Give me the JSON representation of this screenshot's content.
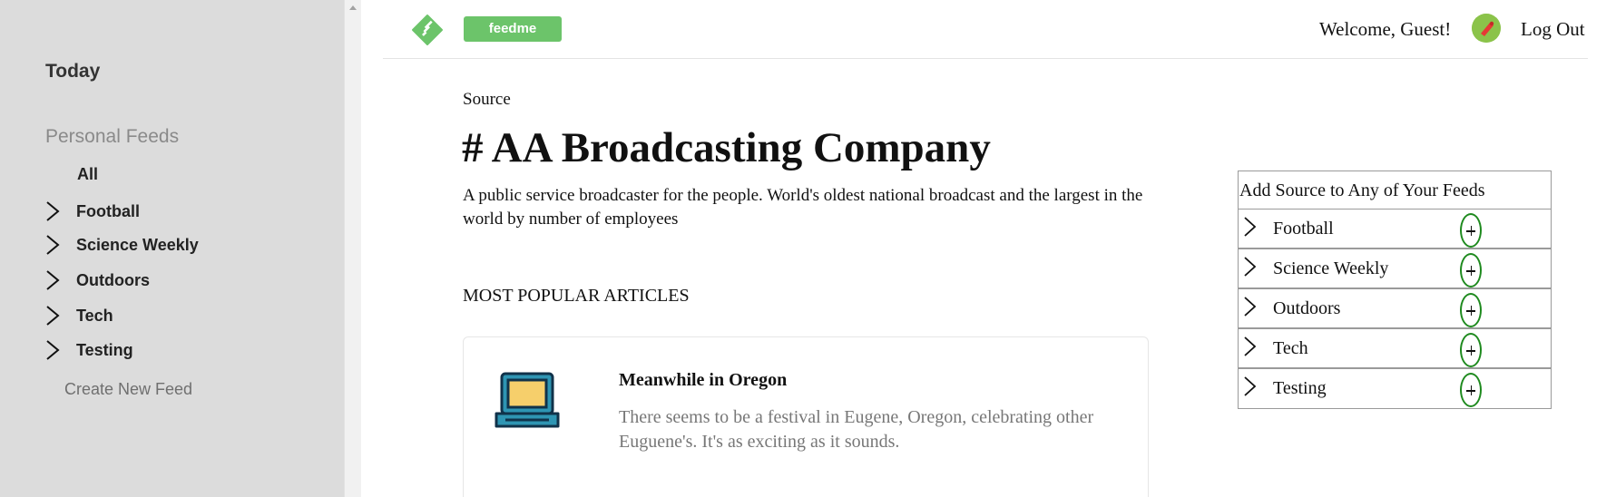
{
  "sidebar": {
    "today": "Today",
    "personal_feeds": "Personal Feeds",
    "all": "All",
    "feeds": [
      {
        "label": "Football"
      },
      {
        "label": "Science Weekly"
      },
      {
        "label": "Outdoors"
      },
      {
        "label": "Tech"
      },
      {
        "label": "Testing"
      }
    ],
    "create": "Create New Feed"
  },
  "header": {
    "brand": "feedme",
    "welcome": "Welcome, Guest!",
    "logout": "Log Out"
  },
  "main": {
    "source_label": "Source",
    "title": "# AA Broadcasting Company",
    "description": "A public service broadcaster for the people. World's oldest national broadcast and the largest in the world by number of employees",
    "popular_heading": "MOST POPULAR ARTICLES",
    "articles": [
      {
        "title": "Meanwhile in Oregon",
        "text": "There seems to be a festival in Eugene, Oregon, celebrating other Euguene's. It's as exciting as it sounds.",
        "icon": "laptop-icon"
      }
    ]
  },
  "widget": {
    "heading": "Add Source to Any of Your Feeds",
    "feeds": [
      {
        "label": "Football"
      },
      {
        "label": "Science Weekly"
      },
      {
        "label": "Outdoors"
      },
      {
        "label": "Tech"
      },
      {
        "label": "Testing"
      }
    ]
  },
  "colors": {
    "sidebar_bg": "#dcdcdc",
    "brand_green": "#6cc46a",
    "plus_border": "#1e8a1e"
  }
}
